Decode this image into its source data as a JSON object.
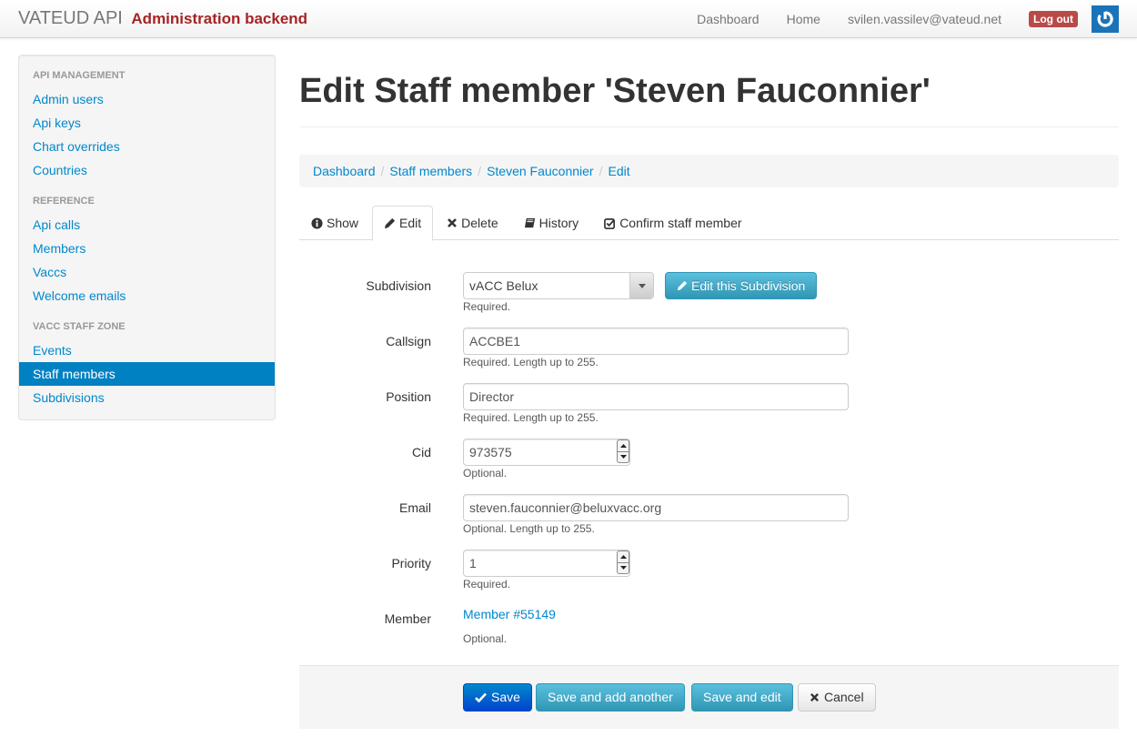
{
  "navbar": {
    "brand": "VATEUD API",
    "subtitle": "Administration backend",
    "links": [
      "Dashboard",
      "Home"
    ],
    "user_email": "svilen.vassilev@vateud.net",
    "logout_label": "Log out",
    "power_icon": "power-icon"
  },
  "sidebar": {
    "sections": [
      {
        "header": "API MANAGEMENT",
        "items": [
          "Admin users",
          "Api keys",
          "Chart overrides",
          "Countries"
        ]
      },
      {
        "header": "REFERENCE",
        "items": [
          "Api calls",
          "Members",
          "Vaccs",
          "Welcome emails"
        ]
      },
      {
        "header": "VACC STAFF ZONE",
        "items": [
          "Events",
          "Staff members",
          "Subdivisions"
        ]
      }
    ],
    "active_item": "Staff members"
  },
  "page": {
    "title": "Edit Staff member 'Steven Fauconnier'",
    "breadcrumb": [
      "Dashboard",
      "Staff members",
      "Steven Fauconnier",
      "Edit"
    ],
    "tabs": [
      {
        "label": "Show",
        "icon": "info-circle-icon"
      },
      {
        "label": "Edit",
        "icon": "pencil-icon",
        "active": true
      },
      {
        "label": "Delete",
        "icon": "times-icon"
      },
      {
        "label": "History",
        "icon": "book-icon"
      },
      {
        "label": "Confirm staff member",
        "icon": "check-square-icon"
      }
    ]
  },
  "form": {
    "subdivision": {
      "label": "Subdivision",
      "value": "vACC Belux",
      "help": "Required.",
      "edit_button": "Edit this Subdivision"
    },
    "callsign": {
      "label": "Callsign",
      "value": "ACCBE1",
      "help": "Required. Length up to 255."
    },
    "position": {
      "label": "Position",
      "value": "Director",
      "help": "Required. Length up to 255."
    },
    "cid": {
      "label": "Cid",
      "value": "973575",
      "help": "Optional."
    },
    "email": {
      "label": "Email",
      "value": "steven.fauconnier@beluxvacc.org",
      "help": "Optional. Length up to 255."
    },
    "priority": {
      "label": "Priority",
      "value": "1",
      "help": "Required."
    },
    "member": {
      "label": "Member",
      "link": "Member #55149",
      "help": "Optional."
    }
  },
  "actions": {
    "save": "Save",
    "save_add": "Save and add another",
    "save_edit": "Save and edit",
    "cancel": "Cancel"
  },
  "colors": {
    "brand_red": "#a52424",
    "link_blue": "#0088cc",
    "active_blue": "#0081c2",
    "logout_red": "#b94a48",
    "info_button": "#2f96b4"
  }
}
